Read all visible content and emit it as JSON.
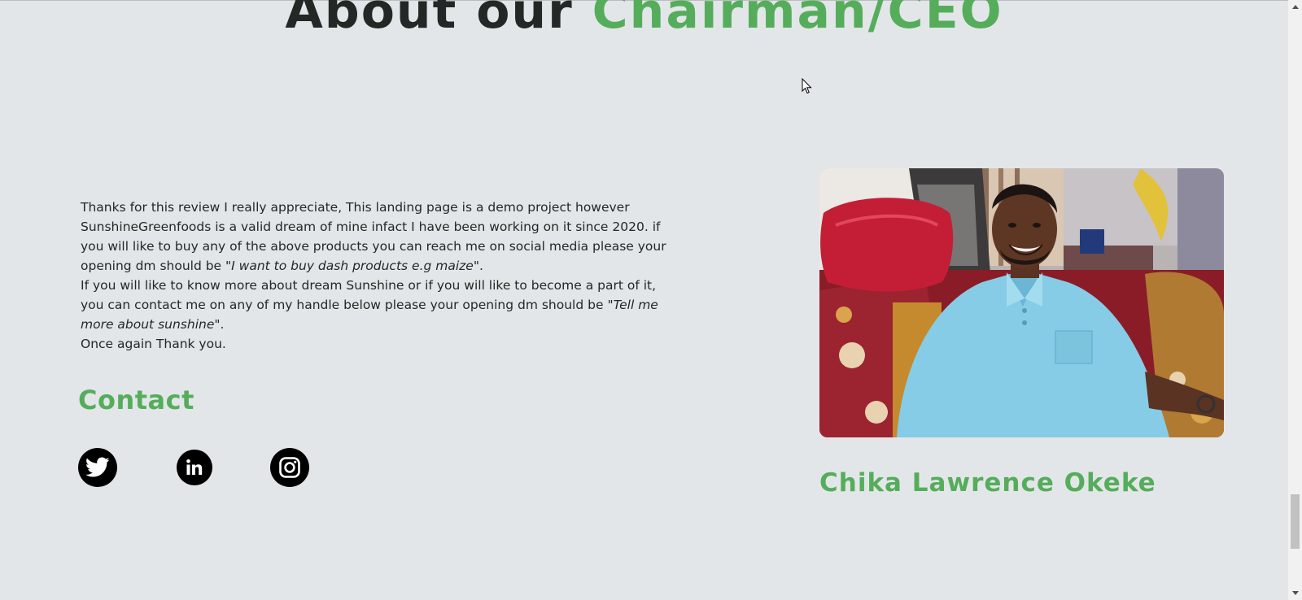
{
  "section": {
    "heading_part1": "About our",
    "heading_part2": "Chairman/CEO"
  },
  "bio": {
    "line1": "Thanks for this review I really appreciate, This landing page is a demo project however SunshineGreenfoods is a valid dream of mine infact I have been working on it since 2020. if you will like to buy any of the above products you can reach me on social media please your opening dm should be ",
    "quote1": "\"I want to buy dash products e.g maize\"",
    "line1_end": ".",
    "line2": "If you will like to know more about dream Sunshine or if you will like to become a part of it, you can contact me on any of my handle below please your opening dm should be ",
    "quote2": "\"Tell me more about sunshine\"",
    "line2_end": ".",
    "line3": "Once again Thank you."
  },
  "contact": {
    "title": "Contact",
    "links": [
      {
        "icon": "twitter-icon"
      },
      {
        "icon": "linkedin-icon"
      },
      {
        "icon": "instagram-icon"
      }
    ]
  },
  "profile": {
    "name": "Chika Lawrence Okeke"
  },
  "colors": {
    "accent": "#55ad5b",
    "background": "#e3e6e8",
    "text": "#222826"
  }
}
